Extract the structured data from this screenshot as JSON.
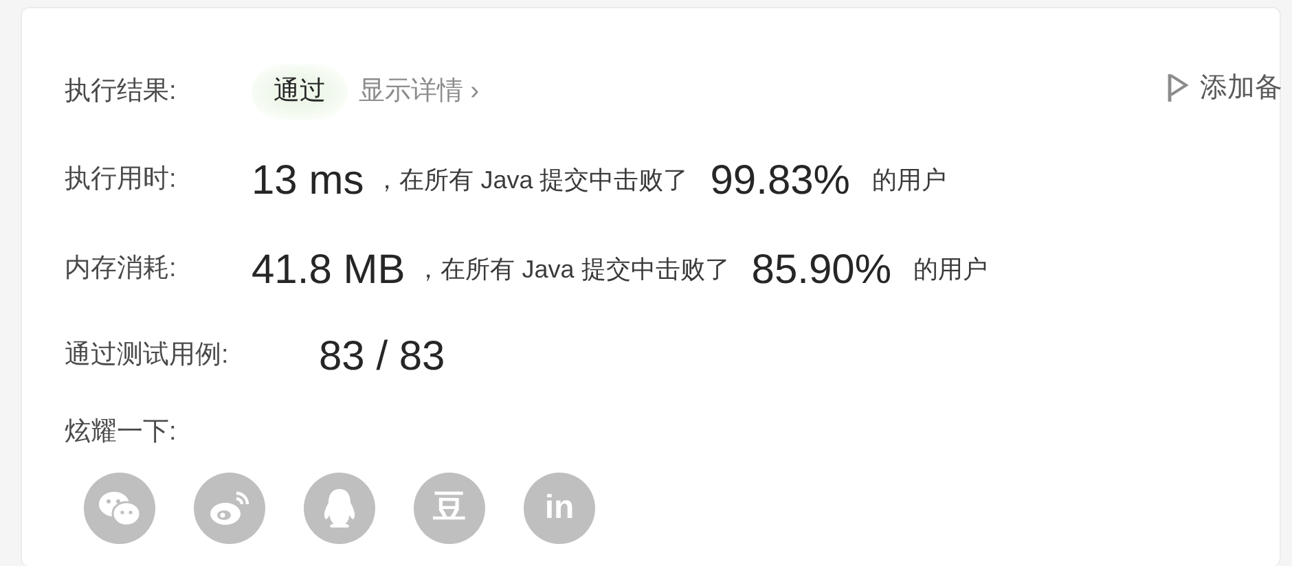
{
  "result": {
    "label": "执行结果:",
    "status": "通过",
    "details_link": "显示详情",
    "details_chevron": "›",
    "note_button": "添加备"
  },
  "stats": [
    {
      "label": "执行用时:",
      "value": "13 ms",
      "text_before": "，在所有 Java 提交中击败了",
      "percent": "99.83%",
      "text_after": "的用户"
    },
    {
      "label": "内存消耗:",
      "value": "41.8 MB",
      "text_before": "，在所有 Java 提交中击败了",
      "percent": "85.90%",
      "text_after": "的用户"
    }
  ],
  "test_cases": {
    "label": "通过测试用例:",
    "value": "83 / 83"
  },
  "share": {
    "label": "炫耀一下:",
    "buttons": [
      {
        "kind": "wechat"
      },
      {
        "kind": "weibo"
      },
      {
        "kind": "qq"
      },
      {
        "kind": "douban",
        "glyph": "豆"
      },
      {
        "kind": "linkedin",
        "glyph": "in"
      }
    ]
  }
}
